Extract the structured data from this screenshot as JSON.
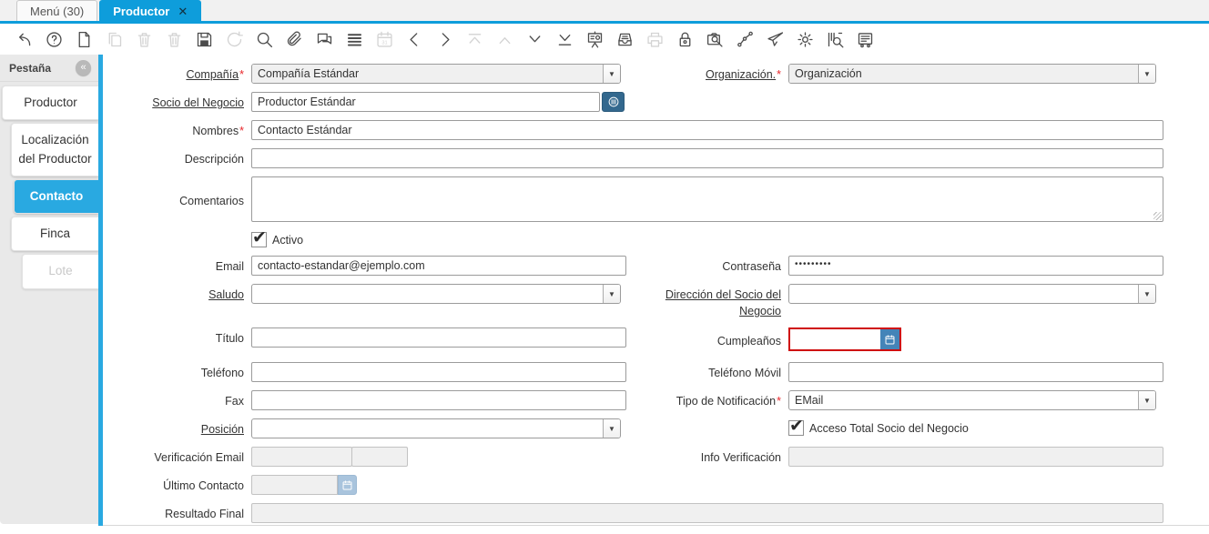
{
  "window_tabs": {
    "items": [
      {
        "label": "Menú (30)",
        "active": false,
        "closable": false
      },
      {
        "label": "Productor",
        "active": true,
        "closable": true,
        "close_glyph": "✕"
      }
    ]
  },
  "toolbar": {
    "items": [
      {
        "icon": "undo",
        "enabled": true
      },
      {
        "icon": "help",
        "enabled": true
      },
      {
        "icon": "new-record",
        "enabled": true
      },
      {
        "icon": "copy-record",
        "enabled": false
      },
      {
        "icon": "delete-record",
        "enabled": false
      },
      {
        "icon": "delete-selection",
        "enabled": false
      },
      {
        "icon": "save",
        "enabled": true
      },
      {
        "icon": "refresh",
        "enabled": false
      },
      {
        "icon": "find",
        "enabled": true
      },
      {
        "icon": "attachment",
        "enabled": true
      },
      {
        "icon": "chat",
        "enabled": true
      },
      {
        "icon": "grid-toggle",
        "enabled": true
      },
      {
        "icon": "calendar",
        "enabled": false
      },
      {
        "icon": "previous-record",
        "enabled": true
      },
      {
        "icon": "next-record",
        "enabled": true
      },
      {
        "icon": "parent-record",
        "enabled": false
      },
      {
        "icon": "up",
        "enabled": false
      },
      {
        "icon": "down",
        "enabled": true
      },
      {
        "icon": "detail-record",
        "enabled": true
      },
      {
        "icon": "report",
        "enabled": true
      },
      {
        "icon": "archive",
        "enabled": true
      },
      {
        "icon": "print",
        "enabled": false
      },
      {
        "icon": "lock",
        "enabled": true
      },
      {
        "icon": "zoom-across",
        "enabled": true
      },
      {
        "icon": "workflow",
        "enabled": true
      },
      {
        "icon": "send-mail",
        "enabled": true
      },
      {
        "icon": "preference",
        "enabled": true
      },
      {
        "icon": "product-info",
        "enabled": true
      },
      {
        "icon": "memo",
        "enabled": true
      }
    ]
  },
  "sidebar": {
    "header": "Pestaña",
    "collapse_glyph": "«",
    "tabs": [
      {
        "key": "productor",
        "label": "Productor",
        "state": "normal",
        "indent": 2
      },
      {
        "key": "localizacion-del-productor",
        "label": "Localización del Productor",
        "state": "normal",
        "indent": 12
      },
      {
        "key": "contacto",
        "label": "Contacto",
        "state": "active",
        "indent": 15
      },
      {
        "key": "finca",
        "label": "Finca",
        "state": "normal",
        "indent": 12
      },
      {
        "key": "lote",
        "label": "Lote",
        "state": "disabled",
        "indent": 24
      }
    ]
  },
  "form": {
    "required_marker": "*",
    "fields": {
      "compania": {
        "label": "Compañía",
        "value": "Compañía Estándar",
        "required": true,
        "readonly": true
      },
      "organizacion": {
        "label": "Organización.",
        "value": "Organización",
        "required": true,
        "readonly": true
      },
      "socio_negocio": {
        "label": "Socio del Negocio",
        "value": "Productor Estándar"
      },
      "nombres": {
        "label": "Nombres",
        "value": "Contacto Estándar",
        "required": true
      },
      "descripcion": {
        "label": "Descripción",
        "value": ""
      },
      "comentarios": {
        "label": "Comentarios",
        "value": ""
      },
      "activo": {
        "label": "Activo",
        "checked": true
      },
      "email": {
        "label": "Email",
        "value": "contacto-estandar@ejemplo.com"
      },
      "contrasena": {
        "label": "Contraseña",
        "value": "•••••••••"
      },
      "saludo": {
        "label": "Saludo",
        "value": ""
      },
      "direccion_socio": {
        "label": "Dirección del Socio del Negocio",
        "value": ""
      },
      "titulo": {
        "label": "Título",
        "value": ""
      },
      "cumpleanos": {
        "label": "Cumpleaños",
        "value": "",
        "focused": true
      },
      "telefono": {
        "label": "Teléfono",
        "value": ""
      },
      "telefono_movil": {
        "label": "Teléfono Móvil",
        "value": ""
      },
      "fax": {
        "label": "Fax",
        "value": ""
      },
      "tipo_notificacion": {
        "label": "Tipo de Notificación",
        "value": "EMail",
        "required": true
      },
      "posicion": {
        "label": "Posición",
        "value": ""
      },
      "acceso_total": {
        "label": "Acceso Total Socio del Negocio",
        "checked": true
      },
      "verificacion_email": {
        "label": "Verificación Email",
        "value1": "",
        "value2": "",
        "disabled": true
      },
      "info_verificacion": {
        "label": "Info Verificación",
        "value": "",
        "disabled": true
      },
      "ultimo_contacto": {
        "label": "Último Contacto",
        "value": "",
        "disabled": true
      },
      "resultado_final": {
        "label": "Resultado Final",
        "value": "",
        "disabled": true
      }
    }
  },
  "colors": {
    "window_tab_active": "#0e9ddb",
    "sidebar_tab_active": "#29a9e1",
    "focus_border_red": "#cf0a0a",
    "required_asterisk": "#e8262a",
    "bp_info_button": "#33688e",
    "calendar_button": "#4484b8",
    "calendar_button_disabled": "#a9c4dd"
  }
}
